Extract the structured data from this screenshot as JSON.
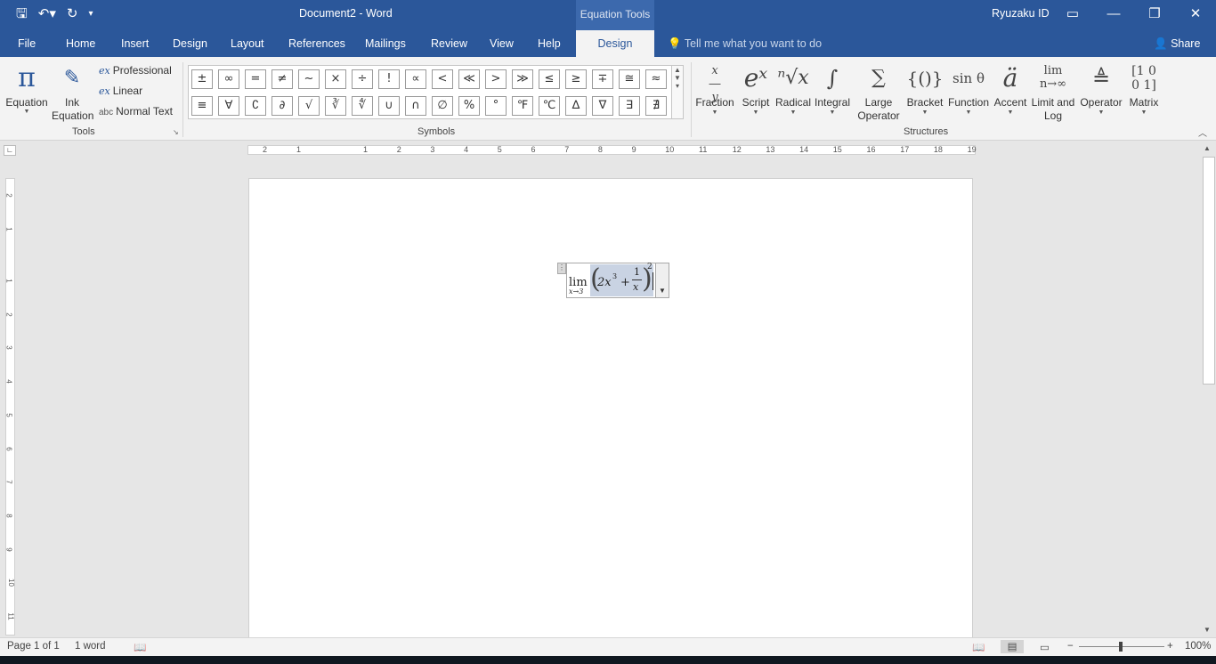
{
  "titlebar": {
    "doc_title": "Document2  -  Word",
    "context_tab": "Equation Tools",
    "user": "Ryuzaku ID"
  },
  "tabs": [
    "File",
    "Home",
    "Insert",
    "Design",
    "Layout",
    "References",
    "Mailings",
    "Review",
    "View",
    "Help",
    "Design"
  ],
  "tell_me": "Tell me what you want to do",
  "share": "Share",
  "tools": {
    "equation": "Equation",
    "ink_line1": "Ink",
    "ink_line2": "Equation",
    "professional": "Professional",
    "linear": "Linear",
    "normal_text": "Normal Text",
    "label": "Tools"
  },
  "symbols": {
    "label": "Symbols",
    "row1": [
      "±",
      "∞",
      "=",
      "≠",
      "~",
      "×",
      "÷",
      "!",
      "∝",
      "<",
      "≪",
      ">",
      "≫",
      "≤",
      "≥",
      "∓",
      "≅",
      "≈"
    ],
    "row2": [
      "≡",
      "∀",
      "∁",
      "∂",
      "√",
      "∛",
      "∜",
      "∪",
      "∩",
      "∅",
      "%",
      "°",
      "℉",
      "℃",
      "∆",
      "∇",
      "∃",
      "∄"
    ]
  },
  "structures": {
    "label": "Structures",
    "items": [
      {
        "label": "Fraction",
        "label2": ""
      },
      {
        "label": "Script",
        "label2": ""
      },
      {
        "label": "Radical",
        "label2": ""
      },
      {
        "label": "Integral",
        "label2": ""
      },
      {
        "label": "Large",
        "label2": "Operator"
      },
      {
        "label": "Bracket",
        "label2": ""
      },
      {
        "label": "Function",
        "label2": ""
      },
      {
        "label": "Accent",
        "label2": ""
      },
      {
        "label": "Limit and",
        "label2": "Log"
      },
      {
        "label": "Operator",
        "label2": ""
      },
      {
        "label": "Matrix",
        "label2": ""
      }
    ]
  },
  "ruler": [
    "2",
    "1",
    "1",
    "2",
    "3",
    "4",
    "5",
    "6",
    "7",
    "8",
    "9",
    "10",
    "11",
    "12",
    "13",
    "14",
    "15",
    "16",
    "17",
    "18",
    "19"
  ],
  "vruler": [
    "2",
    "1",
    "1",
    "2",
    "3",
    "4",
    "5",
    "6",
    "7",
    "8",
    "9",
    "10",
    "11"
  ],
  "equation": {
    "lim": "lim",
    "sub": "x→3",
    "body_2x": "2x",
    "exp3": "3",
    "plus": "+",
    "num": "1",
    "den": "x",
    "outer_exp": "2"
  },
  "status": {
    "page": "Page 1 of 1",
    "words": "1 word",
    "zoom": "100%"
  }
}
